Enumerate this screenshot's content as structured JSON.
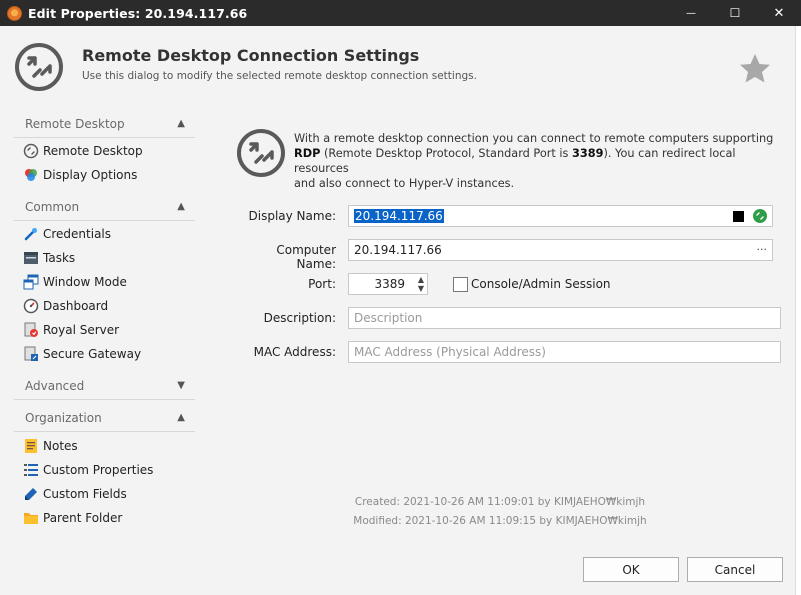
{
  "window": {
    "title": "Edit Properties: 20.194.117.66",
    "minimize_glyph": "—",
    "maximize_glyph": "☐",
    "close_glyph": "✕"
  },
  "header": {
    "title": "Remote Desktop Connection Settings",
    "subtitle": "Use this dialog to modify the selected remote desktop connection settings."
  },
  "sidebar": {
    "sections": [
      {
        "label": "Remote Desktop",
        "expanded": true,
        "items": [
          {
            "label": "Remote Desktop",
            "icon": "remote-desktop-icon"
          },
          {
            "label": "Display Options",
            "icon": "display-options-icon"
          }
        ]
      },
      {
        "label": "Common",
        "expanded": true,
        "items": [
          {
            "label": "Credentials",
            "icon": "credentials-icon"
          },
          {
            "label": "Tasks",
            "icon": "tasks-icon"
          },
          {
            "label": "Window Mode",
            "icon": "window-mode-icon"
          },
          {
            "label": "Dashboard",
            "icon": "dashboard-icon"
          },
          {
            "label": "Royal Server",
            "icon": "royal-server-icon"
          },
          {
            "label": "Secure Gateway",
            "icon": "secure-gateway-icon"
          }
        ]
      },
      {
        "label": "Advanced",
        "expanded": false,
        "items": []
      },
      {
        "label": "Organization",
        "expanded": true,
        "items": [
          {
            "label": "Notes",
            "icon": "notes-icon"
          },
          {
            "label": "Custom Properties",
            "icon": "custom-properties-icon"
          },
          {
            "label": "Custom Fields",
            "icon": "custom-fields-icon"
          },
          {
            "label": "Parent Folder",
            "icon": "parent-folder-icon"
          }
        ]
      }
    ]
  },
  "info": {
    "line1": "With a remote desktop connection you can connect to remote computers supporting",
    "rdp": "RDP",
    "line2a": " (Remote Desktop Protocol, Standard Port is ",
    "port_bold": "3389",
    "line2b": "). You can redirect local resources",
    "line3": "and also connect to Hyper-V instances."
  },
  "form": {
    "display_name_label": "Display Name:",
    "display_name_value": "20.194.117.66",
    "computer_name_label": "Computer Name:",
    "computer_name_value": "20.194.117.66",
    "computer_name_browse": "···",
    "port_label": "Port:",
    "port_value": "3389",
    "console_label": "Console/Admin Session",
    "console_checked": false,
    "description_label": "Description:",
    "description_placeholder": "Description",
    "mac_label": "MAC Address:",
    "mac_placeholder": "MAC Address (Physical Address)"
  },
  "meta": {
    "created": "Created: 2021-10-26 AM 11:09:01 by KIMJAEHO₩kimjh",
    "modified": "Modified: 2021-10-26 AM 11:09:15 by KIMJAEHO₩kimjh"
  },
  "buttons": {
    "ok": "OK",
    "cancel": "Cancel"
  },
  "colors": {
    "titlebar": "#2b2b2b",
    "selection": "#0a64c8",
    "icon_gray": "#5a5a5a"
  }
}
